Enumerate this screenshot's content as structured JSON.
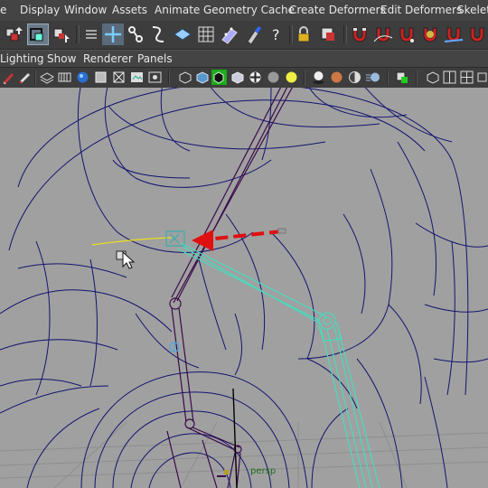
{
  "menubar": {
    "items": [
      "e",
      "Display",
      "Window",
      "Assets",
      "Animate",
      "Geometry Cache",
      "Create Deformers",
      "Edit Deformers",
      "Skeleto"
    ]
  },
  "shelf": {
    "icons": [
      "select-hierarchy",
      "select-object",
      "select-component",
      "lasso",
      "move",
      "joint",
      "ik-handle",
      "curve",
      "plane",
      "cube-lattice",
      "cluster",
      "paint",
      "help",
      "lock",
      "snap-toggle",
      "magnet-1",
      "magnet-2",
      "magnet-3",
      "magnet-4",
      "magnet-5"
    ]
  },
  "panel_menu": {
    "items": [
      "Lighting",
      "Show",
      "Renderer",
      "Panels"
    ]
  },
  "viewport": {
    "camera_label": "persp",
    "colors": {
      "background": "#a0a0a0",
      "wireframe": "#141470",
      "selected_joint": "#40e0c0",
      "joint": "#3a0a4a",
      "curve": "#e8e020",
      "annotation_arrow": "#e01010",
      "grid": "#8c8c8c"
    }
  }
}
